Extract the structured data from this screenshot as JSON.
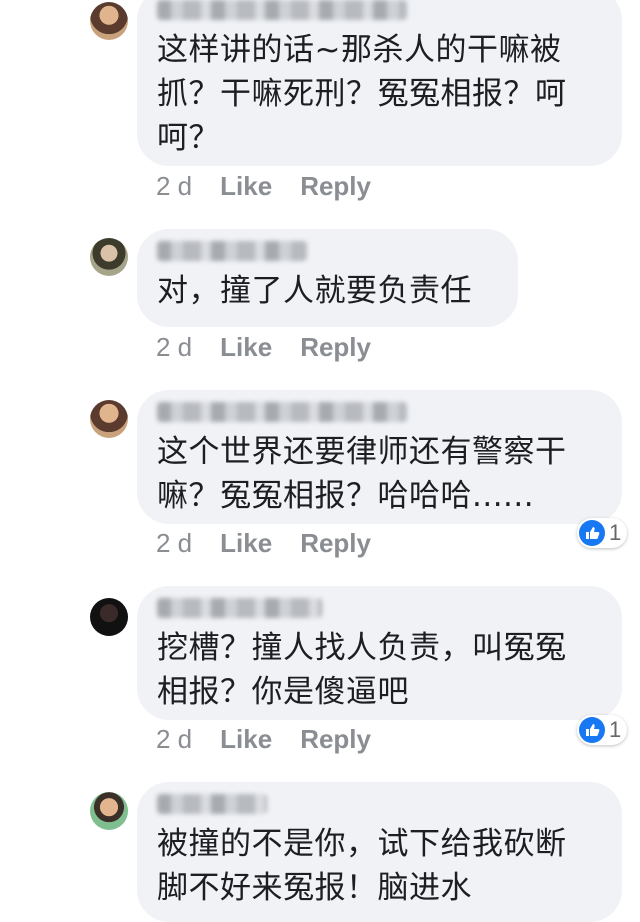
{
  "comments": [
    {
      "text": "这样讲的话~那杀人的干嘛被\n抓？干嘛死刑？冤冤相报？呵\n呵？",
      "time": "2 d",
      "like_label": "Like",
      "reply_label": "Reply",
      "avatar_colors": [
        "#5a3b2e",
        "#c9a27c"
      ]
    },
    {
      "text": "对，撞了人就要负责任",
      "time": "2 d",
      "like_label": "Like",
      "reply_label": "Reply",
      "avatar_colors": [
        "#a6a58a",
        "#3d3b2b"
      ]
    },
    {
      "text": "这个世界还要律师还有警察干\n嘛？冤冤相报？哈哈哈......",
      "time": "2 d",
      "like_label": "Like",
      "reply_label": "Reply",
      "reaction_count": "1",
      "avatar_colors": [
        "#5a3b2e",
        "#c9a27c"
      ]
    },
    {
      "text": "挖槽？撞人找人负责，叫冤冤\n相报？你是傻逼吧",
      "time": "2 d",
      "like_label": "Like",
      "reply_label": "Reply",
      "reaction_count": "1",
      "avatar_colors": [
        "#111111",
        "#3a2a2a"
      ]
    },
    {
      "text": "被撞的不是你，试下给我砍断\n脚不好来冤报！脑进水",
      "avatar_colors": [
        "#7fbf8f",
        "#3b2f2a"
      ]
    }
  ],
  "colors": {
    "bubble": "#f0f2f5",
    "meta": "#8a8d91",
    "like_blue": "#1877f2"
  },
  "icons": {
    "reaction": "thumbs-up-icon"
  }
}
